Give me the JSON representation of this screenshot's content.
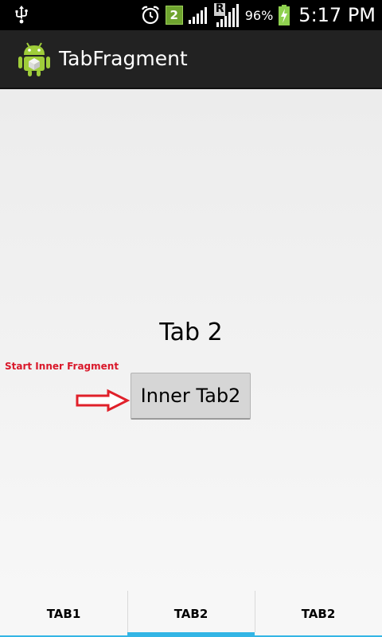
{
  "status_bar": {
    "notification_count": "2",
    "network_letter": "R",
    "battery_percent": "96%",
    "time": "5:17 PM",
    "icons": [
      "usb-icon",
      "alarm-icon",
      "notification-badge",
      "signal-icon",
      "roaming-signal-icon",
      "battery-charging-icon"
    ]
  },
  "action_bar": {
    "title": "TabFragment",
    "icon": "android-icon"
  },
  "content": {
    "tab_label": "Tab 2",
    "annotation": "Start Inner Fragment",
    "inner_button_label": "Inner Tab2"
  },
  "tabs": [
    {
      "label": "TAB1",
      "selected": false
    },
    {
      "label": "TAB2",
      "selected": true
    },
    {
      "label": "TAB2",
      "selected": false
    }
  ],
  "colors": {
    "accent": "#33b5e5",
    "annotation": "#d9182a",
    "action_bar": "#222222"
  }
}
